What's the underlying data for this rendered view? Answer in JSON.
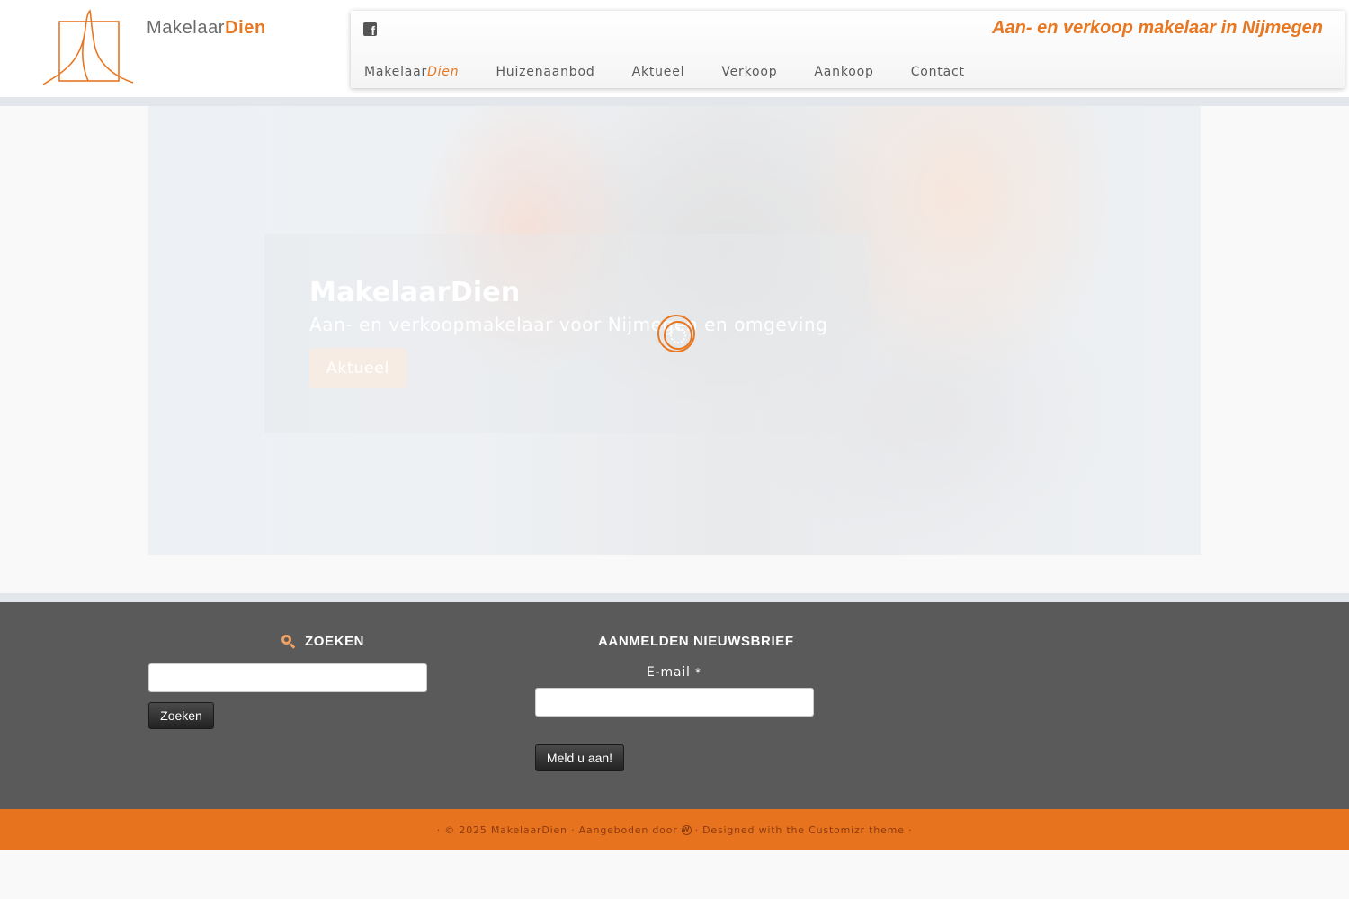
{
  "header": {
    "logo_name": "Makelaar",
    "logo_accent": "Dien",
    "tagline": "Aan- en verkoop makelaar in Nijmegen",
    "social_icon": "facebook-icon",
    "menu": [
      {
        "label": "Makelaar",
        "accent": "Dien"
      },
      {
        "label": "Huizenaanbod"
      },
      {
        "label": "Aktueel"
      },
      {
        "label": "Verkoop"
      },
      {
        "label": "Aankoop"
      },
      {
        "label": "Contact"
      }
    ]
  },
  "hero": {
    "title": "MakelaarDien",
    "subtitle": "Aan- en verkoopmakelaar voor Nijmegen en omgeving",
    "button_label": "Aktueel"
  },
  "footer": {
    "search": {
      "title": "Zoeken",
      "button_label": "Zoeken",
      "input_value": ""
    },
    "newsletter": {
      "title": "Aanmelden nieuwsbrief",
      "email_label": "E-mail",
      "required_mark": "*",
      "input_value": "",
      "button_label": "Meld u aan!"
    },
    "copyright": {
      "before": "· © 2025 MakelaarDien · Aangeboden door",
      "wp_glyph": "W",
      "after": "· Designed with the Customizr theme ·"
    }
  },
  "colors": {
    "accent": "#e87722",
    "footer_bg": "#5a5a5a",
    "copy_bar_bg": "#e8731f"
  }
}
